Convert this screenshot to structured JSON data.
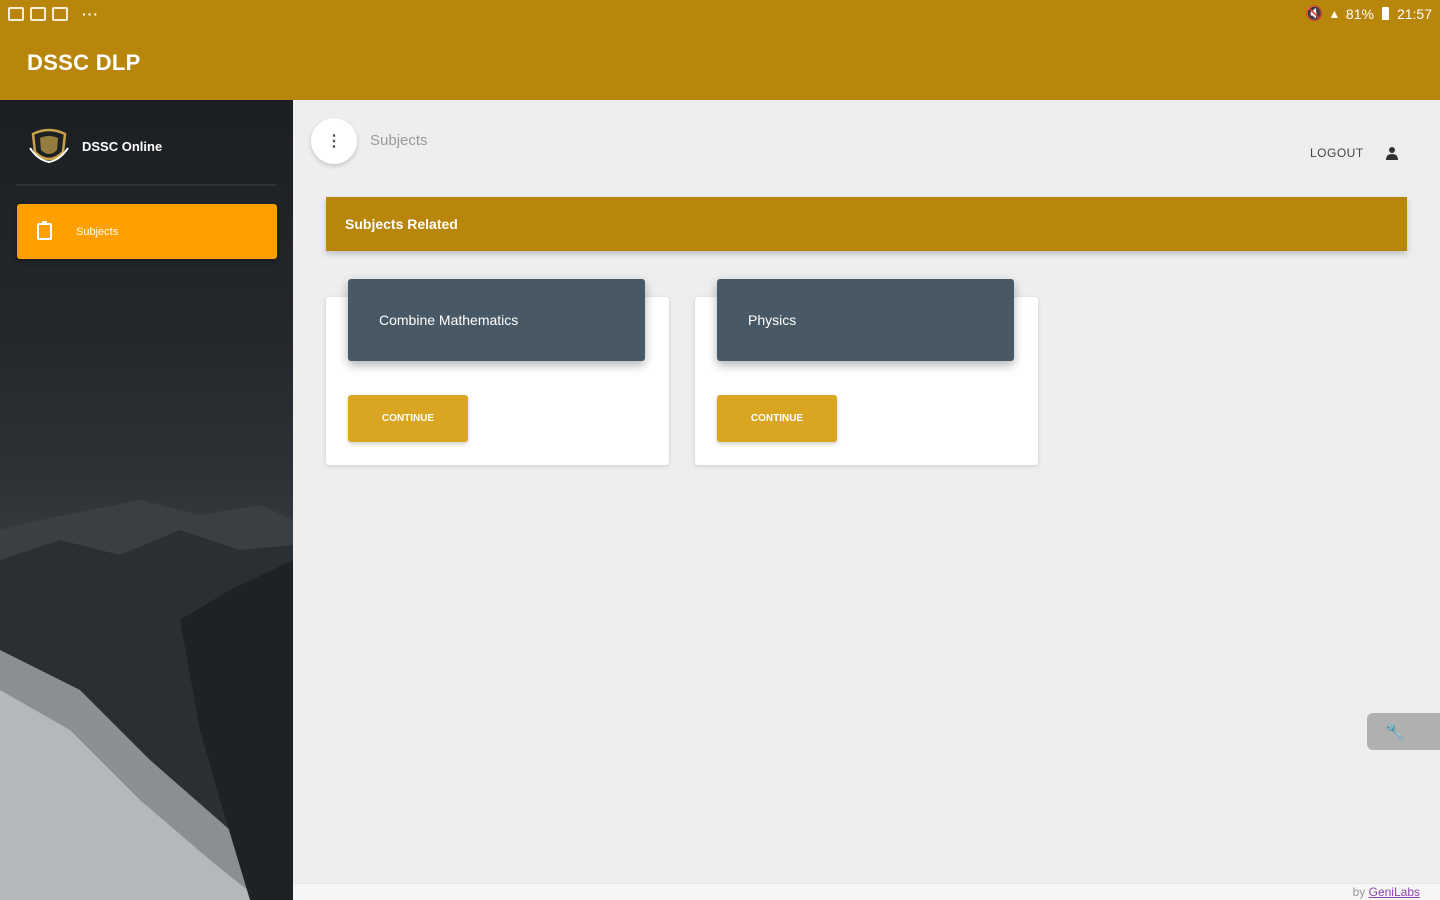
{
  "status_bar": {
    "left_icons": [
      "image-icon",
      "youtube-icon",
      "gallery-icon"
    ],
    "more": "···",
    "battery_pct": "81%",
    "time": "21:57"
  },
  "app": {
    "title": "DSSC DLP"
  },
  "sidebar": {
    "brand": "DSSC Online",
    "items": [
      {
        "label": "Subjects",
        "icon": "clipboard-icon",
        "active": true
      }
    ]
  },
  "header": {
    "menu_glyph": "⋮",
    "page_title": "Subjects",
    "logout_label": "LOGOUT"
  },
  "section": {
    "title": "Subjects Related"
  },
  "cards": [
    {
      "title": "Combine Mathematics",
      "button": "CONTINUE"
    },
    {
      "title": "Physics",
      "button": "CONTINUE"
    }
  ],
  "footer": {
    "prefix": "by",
    "link": "GeniLabs"
  },
  "colors": {
    "primary": "#b8860b",
    "active_nav": "#ffa000",
    "card_header": "#485965",
    "button": "#daa520"
  }
}
